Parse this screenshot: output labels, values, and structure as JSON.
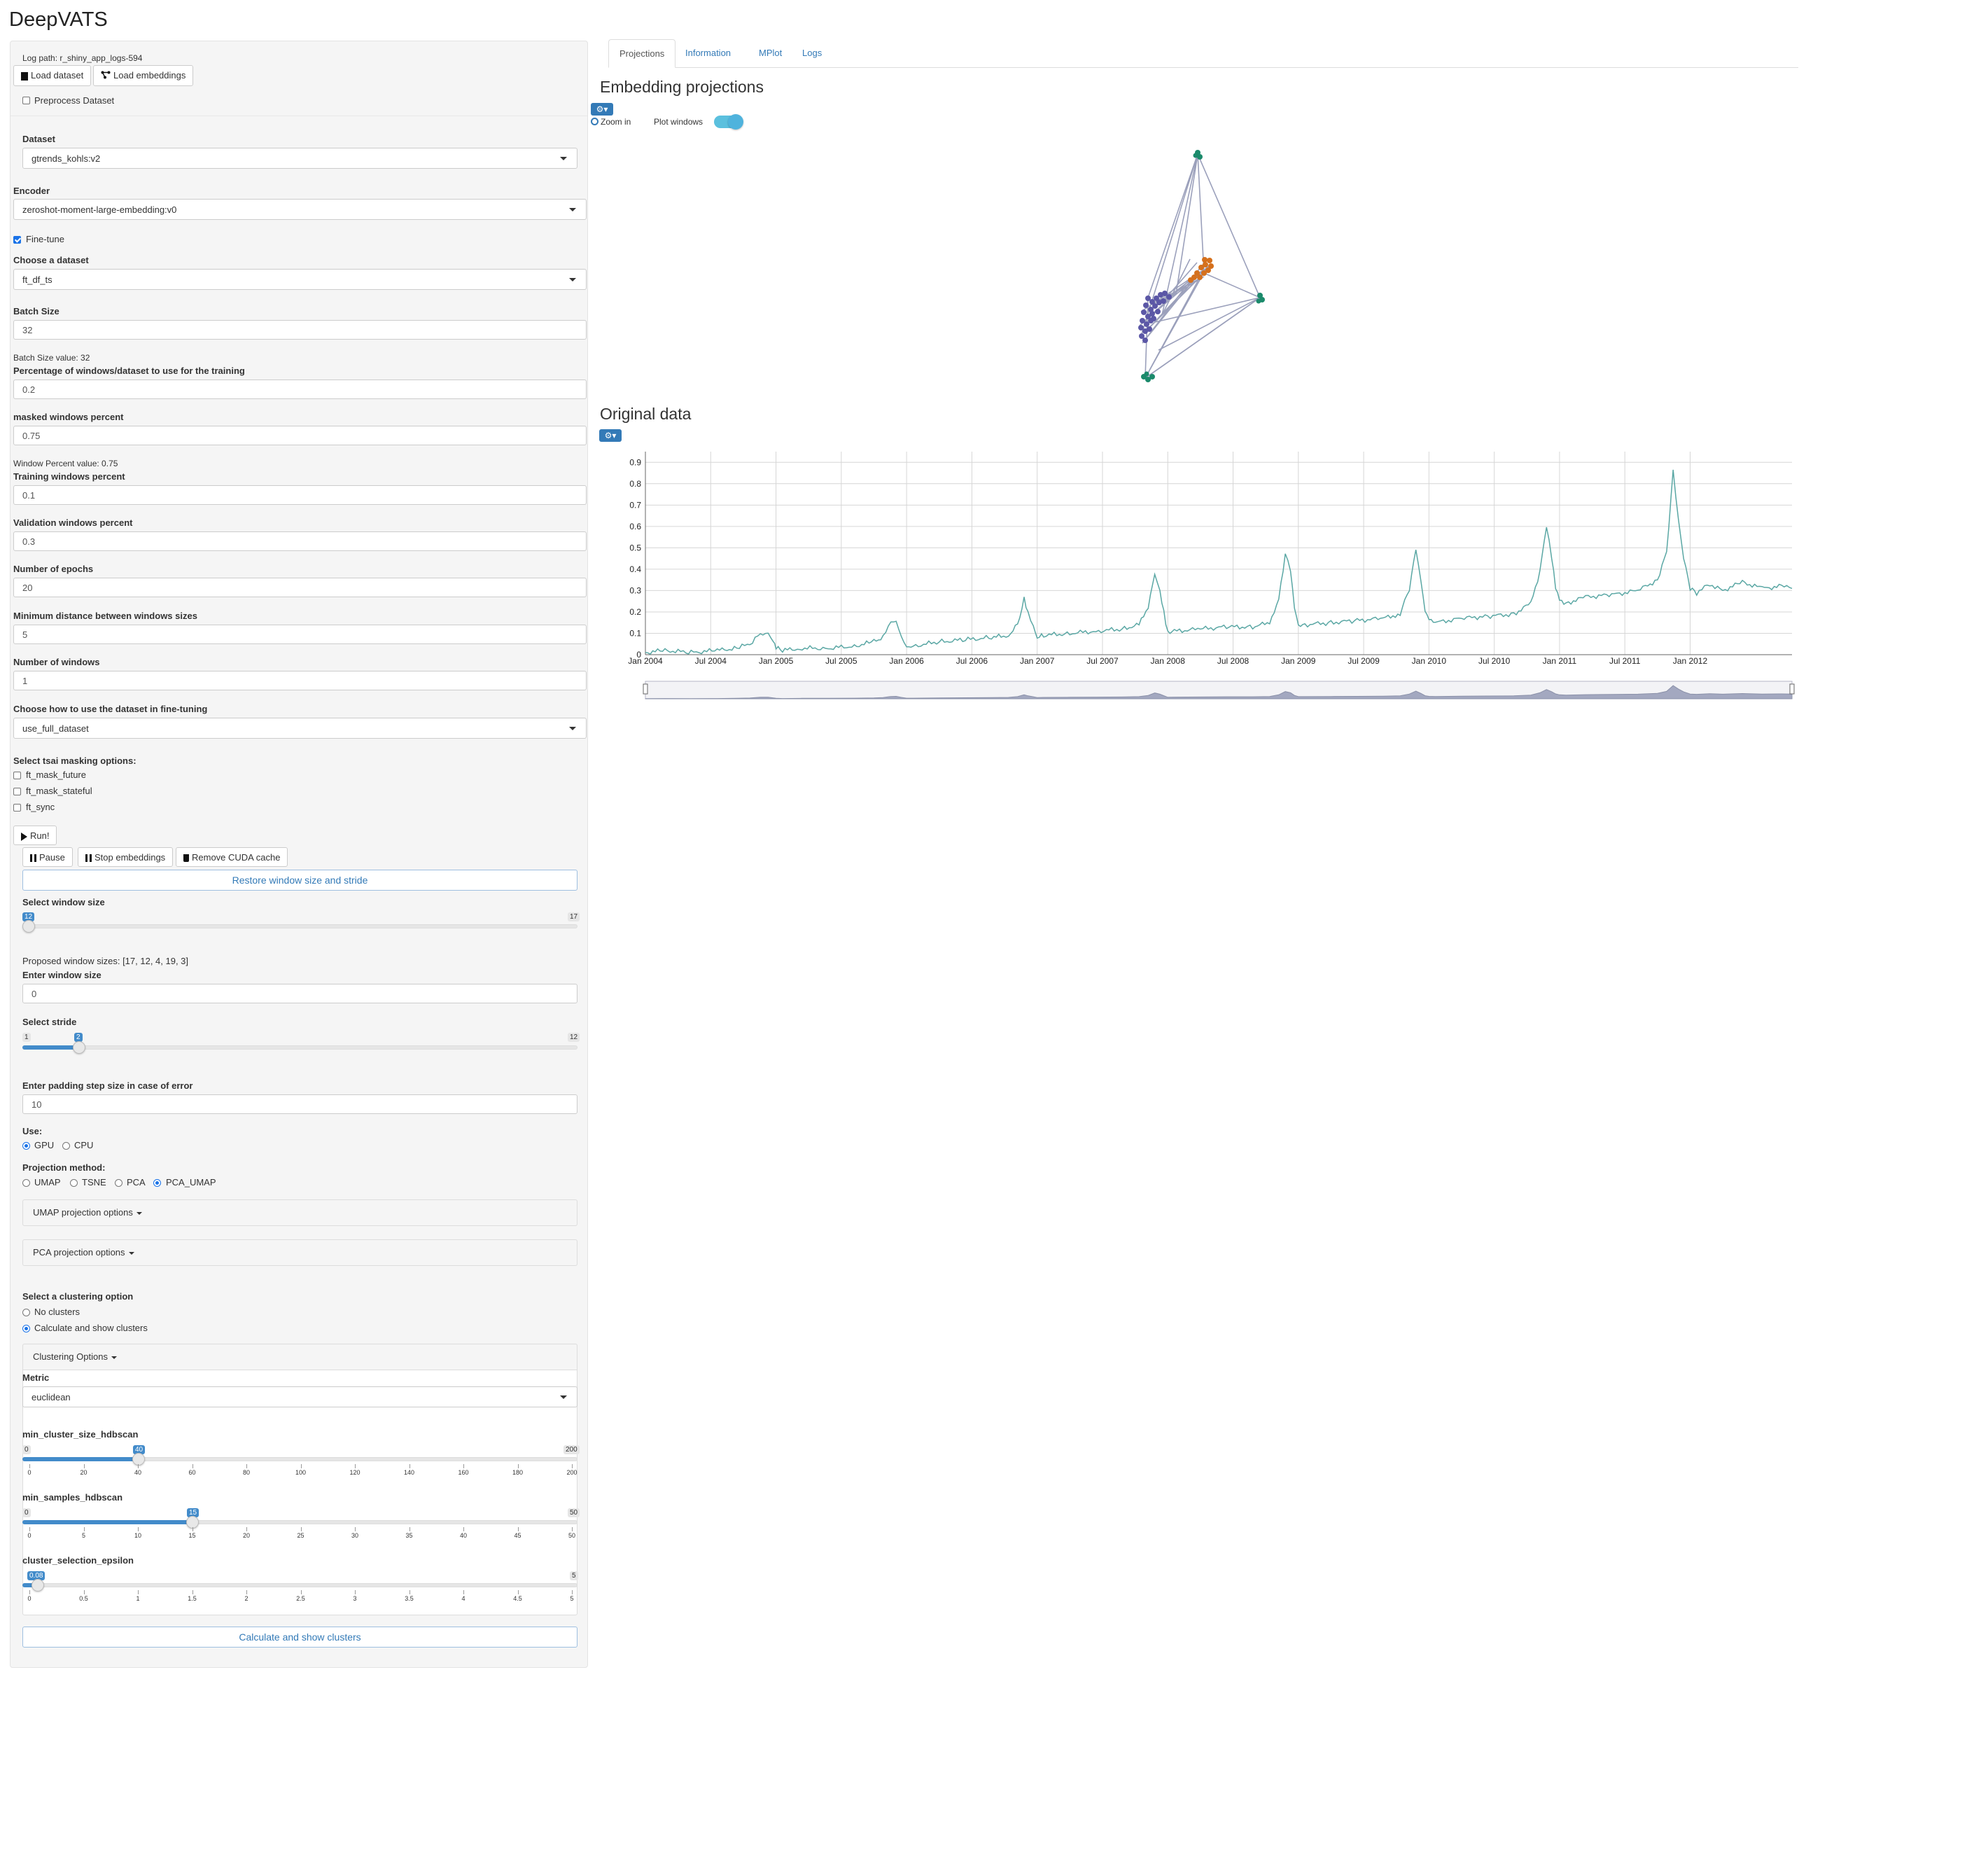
{
  "app_title": "DeepVATS",
  "sidebar": {
    "log_path": "Log path: r_shiny_app_logs-594",
    "load_dataset_label": "Load dataset",
    "load_embeddings_label": "Load embeddings",
    "preprocess_label": "Preprocess Dataset",
    "dataset_label": "Dataset",
    "dataset_value": "gtrends_kohls:v2",
    "encoder_label": "Encoder",
    "encoder_value": "zeroshot-moment-large-embedding:v0",
    "finetune_label": "Fine-tune",
    "choose_dataset_label": "Choose a dataset",
    "choose_dataset_value": "ft_df_ts",
    "batch_size_label": "Batch Size",
    "batch_size_value": "32",
    "batch_size_info": "Batch Size value: 32",
    "pct_windows_label": "Percentage of windows/dataset to use for the training",
    "pct_windows_value": "0.2",
    "masked_label": "masked windows percent",
    "masked_value": "0.75",
    "window_pct_info": "Window Percent value: 0.75",
    "training_label": "Training windows percent",
    "training_value": "0.1",
    "validation_label": "Validation windows percent",
    "validation_value": "0.3",
    "epochs_label": "Number of epochs",
    "epochs_value": "20",
    "min_dist_label": "Minimum distance between windows sizes",
    "min_dist_value": "5",
    "num_windows_label": "Number of windows",
    "num_windows_value": "1",
    "use_dataset_label": "Choose how to use the dataset in fine-tuning",
    "use_dataset_value": "use_full_dataset",
    "masking_label": "Select tsai masking options:",
    "masking_options": [
      "ft_mask_future",
      "ft_mask_stateful",
      "ft_sync"
    ],
    "run_label": "Run!",
    "pause_label": "Pause",
    "stop_label": "Stop embeddings",
    "remove_cuda_label": "Remove CUDA cache",
    "restore_label": "Restore window size and stride",
    "window_size_label": "Select window size",
    "window_size_slider": {
      "min": "12",
      "max": "17",
      "value": "12",
      "fraction": 0.0
    },
    "proposed_sizes": "Proposed window sizes: [17, 12, 4, 19, 3]",
    "enter_window_label": "Enter window size",
    "enter_window_value": "0",
    "stride_label": "Select stride",
    "stride_slider": {
      "min": "1",
      "max": "12",
      "value": "2",
      "fraction": 0.0909
    },
    "padding_label": "Enter padding step size in case of error",
    "padding_value": "10",
    "use_label": "Use:",
    "use_options": [
      "GPU",
      "CPU"
    ],
    "use_selected": "GPU",
    "projection_label": "Projection method:",
    "projection_options": [
      "UMAP",
      "TSNE",
      "PCA",
      "PCA_UMAP"
    ],
    "projection_selected": "PCA_UMAP",
    "umap_panel": "UMAP projection options",
    "pca_panel": "PCA projection options",
    "clustering_label": "Select a clustering option",
    "clustering_options": [
      "No clusters",
      "Calculate and show clusters"
    ],
    "clustering_selected": "Calculate and show clusters",
    "clustering_panel": "Clustering Options",
    "metric_label": "Metric",
    "metric_value": "euclidean",
    "min_cluster_label": "min_cluster_size_hdbscan",
    "min_cluster_slider": {
      "min": "0",
      "max": "200",
      "value": "40",
      "fraction": 0.2,
      "ticks": [
        "0",
        "20",
        "40",
        "60",
        "80",
        "100",
        "120",
        "140",
        "160",
        "180",
        "200"
      ]
    },
    "min_samples_label": "min_samples_hdbscan",
    "min_samples_slider": {
      "min": "0",
      "max": "50",
      "value": "15",
      "fraction": 0.3,
      "ticks": [
        "0",
        "5",
        "10",
        "15",
        "20",
        "25",
        "30",
        "35",
        "40",
        "45",
        "50"
      ]
    },
    "epsilon_label": "cluster_selection_epsilon",
    "epsilon_slider": {
      "min": "0",
      "max": "5",
      "value": "0.08",
      "fraction": 0.016,
      "ticks": [
        "0",
        "0.5",
        "1",
        "1.5",
        "2",
        "2.5",
        "3",
        "3.5",
        "4",
        "4.5",
        "5"
      ]
    },
    "calc_button": "Calculate and show clusters"
  },
  "tabs": [
    "Projections",
    "Information",
    "MPlot",
    "Logs"
  ],
  "active_tab": "Projections",
  "projections": {
    "heading": "Embedding projections",
    "zoom_label": "Zoom in",
    "plot_windows_label": "Plot windows"
  },
  "original": {
    "heading": "Original data"
  },
  "colors": {
    "accent": "#337ab7",
    "series": "#5aa7a4",
    "cluster_purple": "#5b57a6",
    "cluster_orange": "#d5701c",
    "cluster_green": "#1b8a6b"
  },
  "icons": [
    "square-icon",
    "share-icon",
    "gear-icon",
    "search-icon",
    "play-icon",
    "pause-icon",
    "trash-icon"
  ],
  "chart_data": {
    "type": "line",
    "y_ticks": [
      "0",
      "0.1",
      "0.2",
      "0.3",
      "0.4",
      "0.5",
      "0.6",
      "0.7",
      "0.8",
      "0.9"
    ],
    "x_ticks": [
      "Jan 2004",
      "Jul 2004",
      "Jan 2005",
      "Jul 2005",
      "Jan 2006",
      "Jul 2006",
      "Jan 2007",
      "Jul 2007",
      "Jan 2008",
      "Jul 2008",
      "Jan 2009",
      "Jul 2009",
      "Jan 2010",
      "Jul 2010",
      "Jan 2011",
      "Jul 2011",
      "Jan 2012"
    ],
    "ylim": [
      0,
      0.95
    ],
    "xlim": [
      "2004-01",
      "2012-10"
    ],
    "grid": true,
    "series": [
      {
        "values": [
          [
            2004.0,
            0.01
          ],
          [
            2004.15,
            0.02
          ],
          [
            2004.35,
            0.01
          ],
          [
            2004.55,
            0.02
          ],
          [
            2004.7,
            0.03
          ],
          [
            2004.8,
            0.05
          ],
          [
            2004.88,
            0.1
          ],
          [
            2004.94,
            0.1
          ],
          [
            2004.98,
            0.06
          ],
          [
            2005.0,
            0.03
          ],
          [
            2005.05,
            0.02
          ],
          [
            2005.2,
            0.03
          ],
          [
            2005.4,
            0.03
          ],
          [
            2005.6,
            0.04
          ],
          [
            2005.75,
            0.06
          ],
          [
            2005.82,
            0.08
          ],
          [
            2005.88,
            0.15
          ],
          [
            2005.92,
            0.16
          ],
          [
            2005.96,
            0.09
          ],
          [
            2006.0,
            0.04
          ],
          [
            2006.05,
            0.04
          ],
          [
            2006.25,
            0.06
          ],
          [
            2006.45,
            0.07
          ],
          [
            2006.65,
            0.08
          ],
          [
            2006.78,
            0.09
          ],
          [
            2006.85,
            0.14
          ],
          [
            2006.9,
            0.26
          ],
          [
            2006.93,
            0.19
          ],
          [
            2006.97,
            0.13
          ],
          [
            2007.0,
            0.08
          ],
          [
            2007.05,
            0.09
          ],
          [
            2007.25,
            0.1
          ],
          [
            2007.45,
            0.11
          ],
          [
            2007.65,
            0.12
          ],
          [
            2007.78,
            0.14
          ],
          [
            2007.85,
            0.22
          ],
          [
            2007.9,
            0.38
          ],
          [
            2007.94,
            0.3
          ],
          [
            2007.97,
            0.2
          ],
          [
            2008.0,
            0.1
          ],
          [
            2008.05,
            0.11
          ],
          [
            2008.25,
            0.12
          ],
          [
            2008.45,
            0.13
          ],
          [
            2008.65,
            0.13
          ],
          [
            2008.78,
            0.15
          ],
          [
            2008.85,
            0.26
          ],
          [
            2008.9,
            0.47
          ],
          [
            2008.94,
            0.39
          ],
          [
            2008.97,
            0.22
          ],
          [
            2009.0,
            0.14
          ],
          [
            2009.05,
            0.14
          ],
          [
            2009.25,
            0.15
          ],
          [
            2009.45,
            0.16
          ],
          [
            2009.65,
            0.17
          ],
          [
            2009.78,
            0.19
          ],
          [
            2009.85,
            0.31
          ],
          [
            2009.9,
            0.5
          ],
          [
            2009.94,
            0.34
          ],
          [
            2009.97,
            0.2
          ],
          [
            2010.0,
            0.16
          ],
          [
            2010.05,
            0.15
          ],
          [
            2010.25,
            0.17
          ],
          [
            2010.45,
            0.18
          ],
          [
            2010.65,
            0.19
          ],
          [
            2010.78,
            0.24
          ],
          [
            2010.85,
            0.39
          ],
          [
            2010.9,
            0.6
          ],
          [
            2010.94,
            0.46
          ],
          [
            2010.97,
            0.32
          ],
          [
            2011.0,
            0.26
          ],
          [
            2011.05,
            0.24
          ],
          [
            2011.2,
            0.27
          ],
          [
            2011.4,
            0.28
          ],
          [
            2011.6,
            0.3
          ],
          [
            2011.75,
            0.35
          ],
          [
            2011.82,
            0.48
          ],
          [
            2011.87,
            0.86
          ],
          [
            2011.91,
            0.63
          ],
          [
            2011.95,
            0.45
          ],
          [
            2012.0,
            0.31
          ],
          [
            2012.05,
            0.29
          ],
          [
            2012.15,
            0.33
          ],
          [
            2012.25,
            0.3
          ],
          [
            2012.4,
            0.34
          ],
          [
            2012.55,
            0.31
          ],
          [
            2012.7,
            0.32
          ],
          [
            2012.78,
            0.31
          ]
        ]
      }
    ]
  }
}
